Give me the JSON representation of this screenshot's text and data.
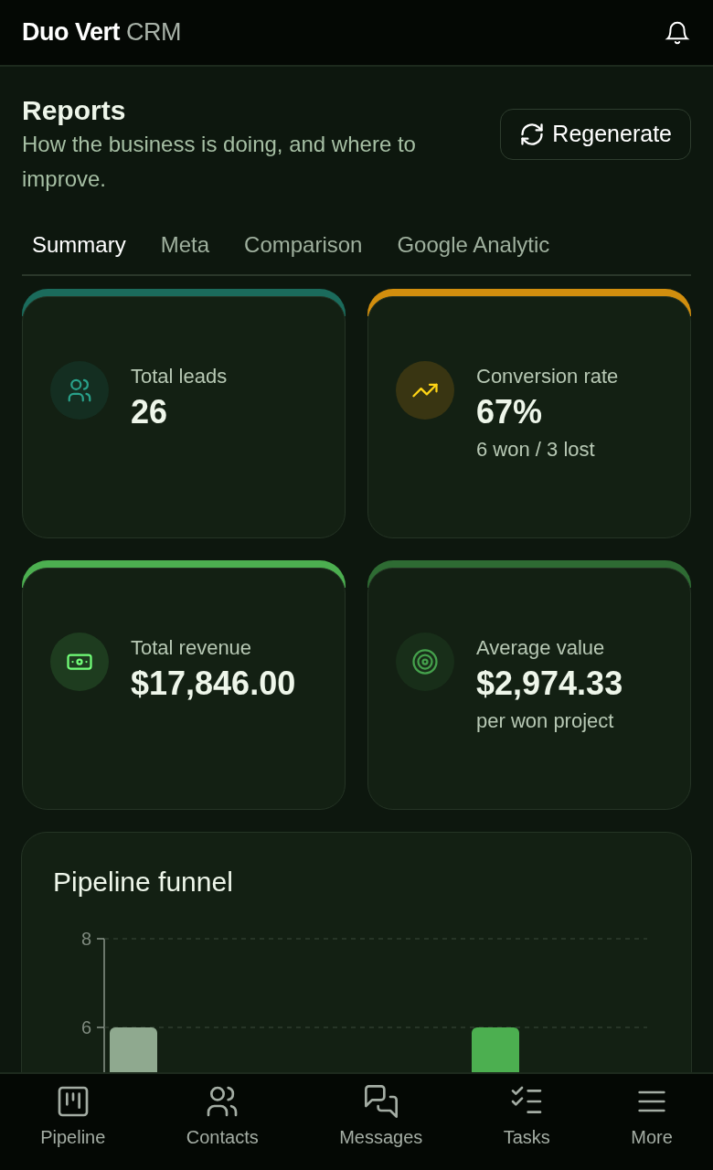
{
  "app": {
    "brand": "Duo Vert",
    "brand_suffix": "CRM"
  },
  "page": {
    "title": "Reports",
    "subtitle": "How the business is doing, and where to improve.",
    "action": "Regenerate"
  },
  "tabs": [
    {
      "label": "Summary",
      "selected": true
    },
    {
      "label": "Meta",
      "selected": false
    },
    {
      "label": "Comparison",
      "selected": false
    },
    {
      "label": "Google Analytic",
      "selected": false
    }
  ],
  "stats": [
    {
      "kind": "users",
      "label": "Total leads",
      "value": "26",
      "color": "#1b6b5c"
    },
    {
      "kind": "trend",
      "label": "Conversion rate",
      "value": "67%",
      "note": "6 won / 3 lost",
      "color": "#d18e0e"
    },
    {
      "kind": "money",
      "label": "Total revenue",
      "value": "$17,846.00",
      "color": "#4caf50"
    },
    {
      "kind": "target",
      "label": "Average value",
      "value": "$2,974.33",
      "note": "per won project",
      "color": "#2e6b33"
    }
  ],
  "funnel": {
    "title": "Pipeline funnel",
    "chart_data": {
      "type": "bar",
      "yticks": [
        6,
        8
      ],
      "ylim": [
        0,
        8
      ],
      "stacked": true,
      "series": [
        {
          "color": "#8fa98f",
          "values": [
            6,
            null,
            null,
            null,
            null,
            null
          ]
        },
        {
          "color": "#4caf50",
          "values": [
            null,
            null,
            null,
            null,
            6,
            null
          ]
        }
      ]
    }
  },
  "bottom_nav": [
    {
      "kind": "pipeline",
      "label": "Pipeline"
    },
    {
      "kind": "contacts",
      "label": "Contacts"
    },
    {
      "kind": "messages",
      "label": "Messages"
    },
    {
      "kind": "tasks",
      "label": "Tasks"
    },
    {
      "kind": "more",
      "label": "More"
    }
  ]
}
